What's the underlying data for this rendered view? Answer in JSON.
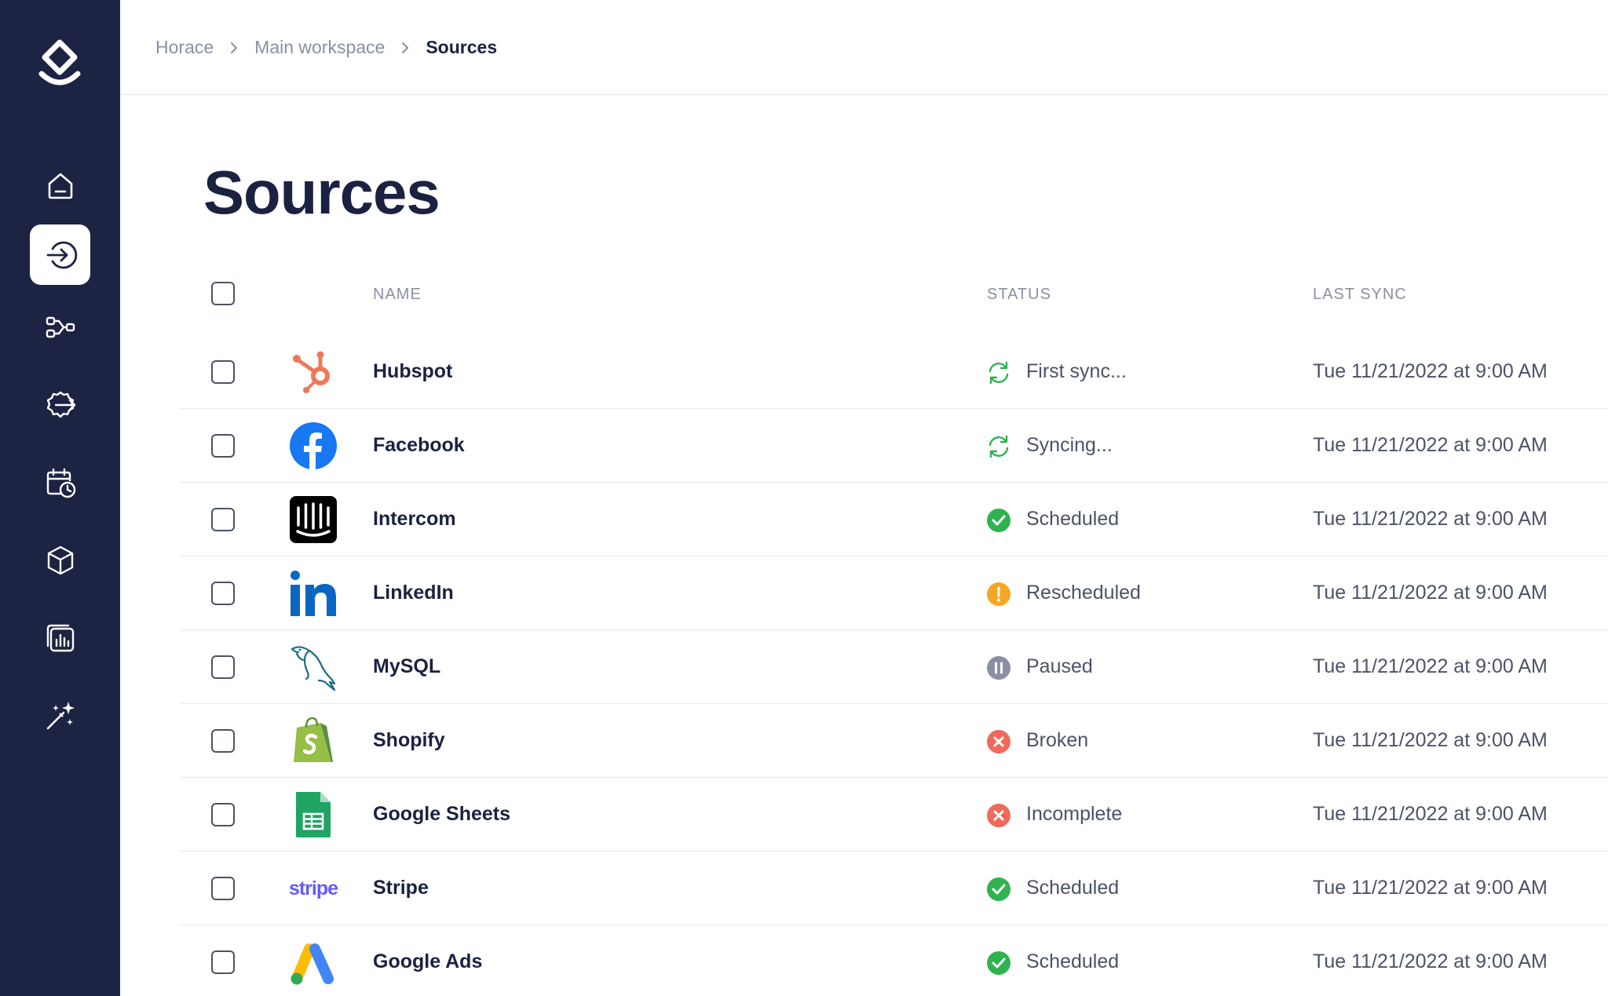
{
  "app": {
    "name": "Horace"
  },
  "sidebar": {
    "logo_icon": "horace-logo-icon",
    "items": [
      {
        "id": "home",
        "icon": "home-icon",
        "active": false
      },
      {
        "id": "sources",
        "icon": "sign-in-arrow-icon",
        "active": true
      },
      {
        "id": "pipelines",
        "icon": "flow-icon",
        "active": false
      },
      {
        "id": "settings",
        "icon": "gear-export-icon",
        "active": false
      },
      {
        "id": "schedules",
        "icon": "calendar-clock-icon",
        "active": false
      },
      {
        "id": "models",
        "icon": "cube-icon",
        "active": false
      },
      {
        "id": "reports",
        "icon": "chart-stack-icon",
        "active": false
      },
      {
        "id": "magic",
        "icon": "magic-wand-icon",
        "active": false
      }
    ]
  },
  "breadcrumb": [
    "Horace",
    "Main workspace",
    "Sources"
  ],
  "page": {
    "title": "Sources"
  },
  "table": {
    "columns": {
      "name": "NAME",
      "status": "STATUS",
      "last_sync": "LAST SYNC"
    },
    "rows": [
      {
        "name": "Hubspot",
        "logo": "hubspot-logo",
        "status": "First sync...",
        "status_type": "syncing",
        "last_sync": "Tue 11/21/2022 at 9:00 AM"
      },
      {
        "name": "Facebook",
        "logo": "facebook-logo",
        "status": "Syncing...",
        "status_type": "syncing",
        "last_sync": "Tue 11/21/2022 at 9:00 AM"
      },
      {
        "name": "Intercom",
        "logo": "intercom-logo",
        "status": "Scheduled",
        "status_type": "success",
        "last_sync": "Tue 11/21/2022 at 9:00 AM"
      },
      {
        "name": "LinkedIn",
        "logo": "linkedin-logo",
        "status": "Rescheduled",
        "status_type": "warning",
        "last_sync": "Tue 11/21/2022 at 9:00 AM"
      },
      {
        "name": "MySQL",
        "logo": "mysql-logo",
        "status": "Paused",
        "status_type": "paused",
        "last_sync": "Tue 11/21/2022 at 9:00 AM"
      },
      {
        "name": "Shopify",
        "logo": "shopify-logo",
        "status": "Broken",
        "status_type": "error",
        "last_sync": "Tue 11/21/2022 at 9:00 AM"
      },
      {
        "name": "Google Sheets",
        "logo": "google-sheets-logo",
        "status": "Incomplete",
        "status_type": "error",
        "last_sync": "Tue 11/21/2022 at 9:00 AM"
      },
      {
        "name": "Stripe",
        "logo": "stripe-logo",
        "logo_text": "stripe",
        "status": "Scheduled",
        "status_type": "success",
        "last_sync": "Tue 11/21/2022 at 9:00 AM"
      },
      {
        "name": "Google Ads",
        "logo": "google-ads-logo",
        "status": "Scheduled",
        "status_type": "success",
        "last_sync": "Tue 11/21/2022 at 9:00 AM"
      }
    ]
  },
  "colors": {
    "sidebar_bg": "#1d2342",
    "text_primary": "#1b2140",
    "text_muted": "#8a90a3",
    "success": "#2fb24f",
    "warning": "#f5a623",
    "error": "#f06a5a",
    "paused": "#8a90a3"
  }
}
